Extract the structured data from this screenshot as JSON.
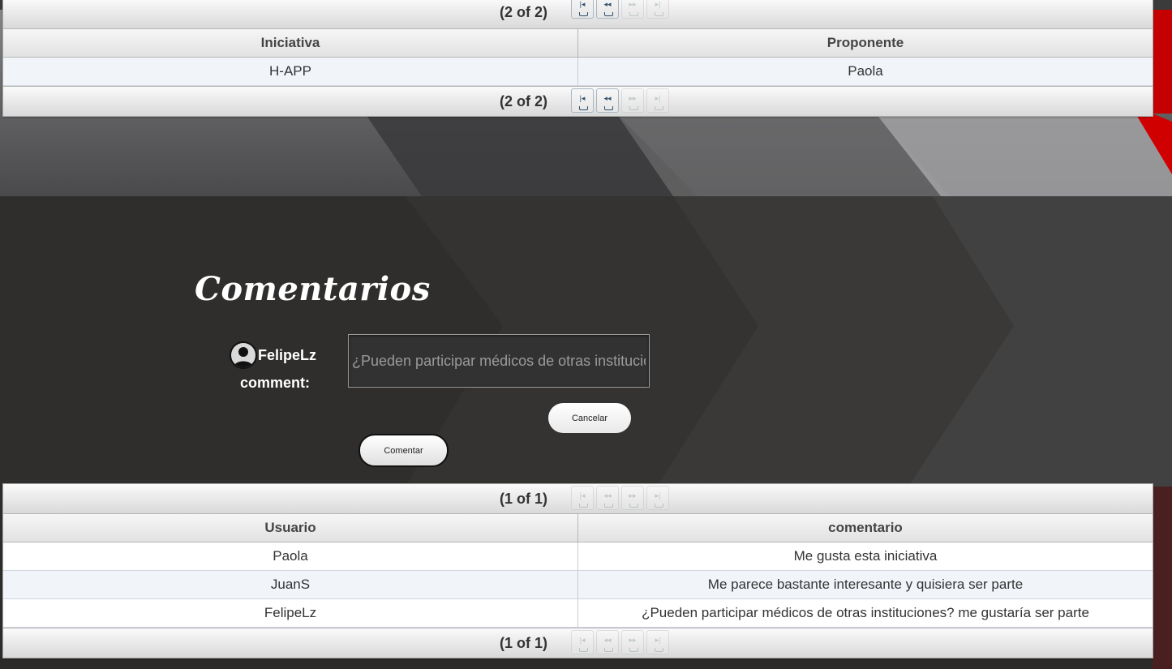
{
  "initiatives_grid": {
    "pager_top_text": "(2 of 2)",
    "pager_bottom_text": "(2 of 2)",
    "columns": [
      "Iniciativa",
      "Proponente"
    ],
    "rows": [
      {
        "iniciativa": "H-APP",
        "proponente": "Paola"
      }
    ]
  },
  "comments_section": {
    "title": "Comentarios",
    "username": "FelipeLz",
    "comment_label": "comment:",
    "comment_value": "¿Pueden participar médicos de otras instituciones? me gustaría ser parte",
    "cancel_label": "Cancelar",
    "submit_label": "Comentar"
  },
  "comments_grid": {
    "pager_top_text": "(1 of 1)",
    "pager_bottom_text": "(1 of 1)",
    "columns": [
      "Usuario",
      "comentario"
    ],
    "rows": [
      {
        "usuario": "Paola",
        "comentario": "Me gusta esta iniciativa"
      },
      {
        "usuario": "JuanS",
        "comentario": "Me parece bastante interesante y quisiera ser parte"
      },
      {
        "usuario": "FelipeLz",
        "comentario": "¿Pueden participar médicos de otras instituciones? me gustaría ser parte"
      }
    ]
  },
  "pager_icons": [
    "first-page-icon",
    "previous-page-icon",
    "next-page-icon",
    "last-page-icon"
  ],
  "colors": {
    "accent_red": "#c40000",
    "dark_bg": "#2d2c2b"
  }
}
